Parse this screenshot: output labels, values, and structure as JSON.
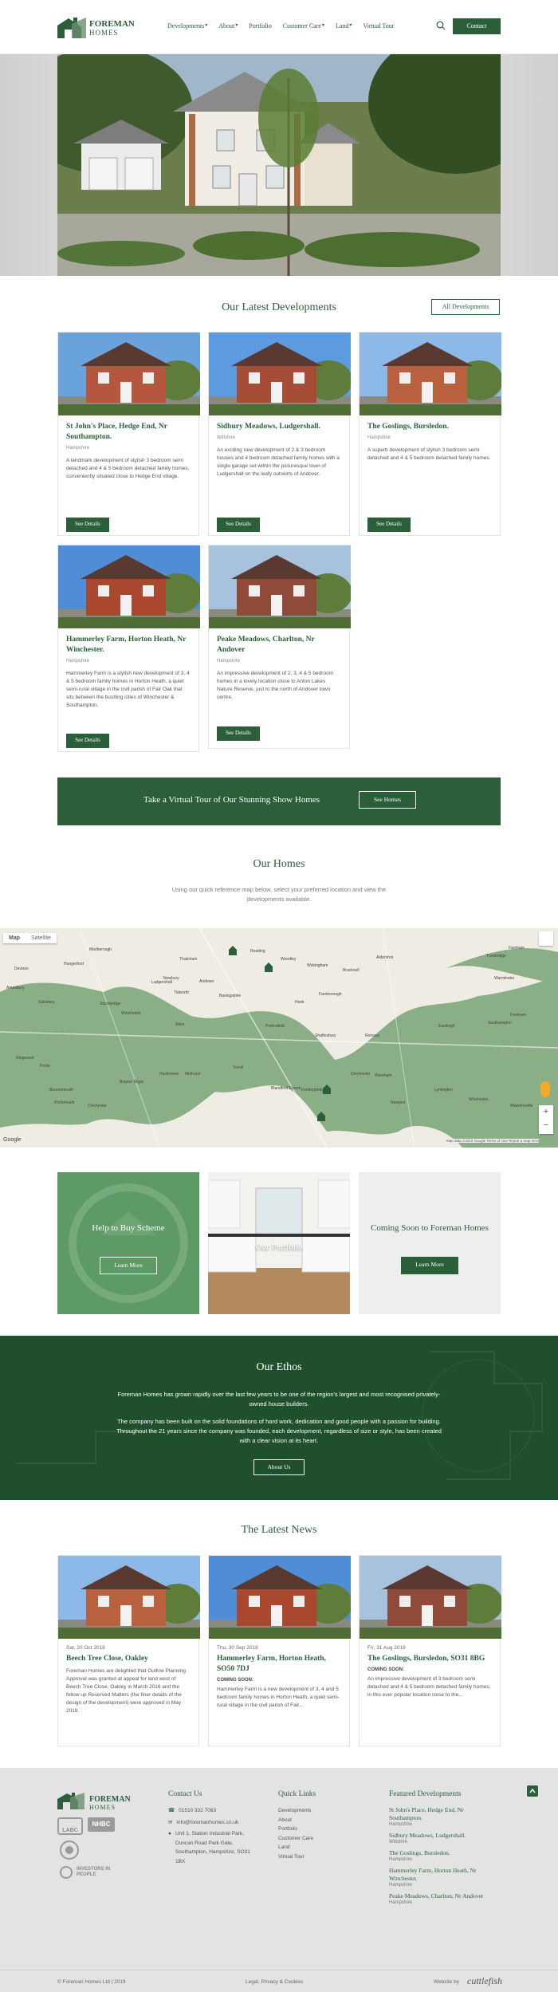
{
  "brand": {
    "name_top": "FOREMAN",
    "name_bottom": "HOMES"
  },
  "nav": {
    "items": [
      "Developments",
      "About",
      "Portfolio",
      "Customer Care",
      "Land",
      "Virtual Tour"
    ],
    "has_dropdown": [
      true,
      true,
      false,
      true,
      true,
      false
    ],
    "contact": "Contact"
  },
  "latest": {
    "title": "Our Latest Developments",
    "all_button": "All Developments",
    "cards": [
      {
        "title": "St John's Place, Hedge End, Nr Southampton.",
        "location": "Hampshire",
        "text": "A landmark development of stylish 3 bedroom semi detached and 4 & 5 bedroom detached family homes, conveniently situated close to Hedge End village.",
        "button": "See Details"
      },
      {
        "title": "Sidbury Meadows, Ludgershall.",
        "location": "Wiltshire",
        "text": "An exciting new development of 2 & 3 bedroom houses and 4 bedroom detached family homes with a single garage set within the picturesque town of Ludgershall on the leafy outskirts of Andover.",
        "button": "See Details"
      },
      {
        "title": "The Goslings, Bursledon.",
        "location": "Hampshire",
        "text": "A superb development of stylish 3 bedroom semi detached and 4 & 5 bedroom detached family homes.",
        "button": "See Details"
      },
      {
        "title": "Hammerley Farm, Horton Heath, Nr Winchester.",
        "location": "Hampshire",
        "text": "Hammerley Farm is a stylish new development of 3, 4 & 5 bedroom family homes in Horton Heath, a quiet semi-rural village in the civil parish of Fair Oak that sits between the bustling cities of Winchester & Southampton.",
        "button": "See Details"
      },
      {
        "title": "Peake Meadows, Charlton, Nr Andover",
        "location": "Hampshire",
        "text": "An impressive development of 2, 3, 4 & 5 bedroom homes in a lovely location close to Anton Lakes Nature Reserve, just to the north of Andover town centre.",
        "button": "See Details"
      }
    ]
  },
  "virtual": {
    "text": "Take a Virtual Tour of Our Stunning Show Homes",
    "button": "See Homes"
  },
  "homes": {
    "title": "Our Homes",
    "subtitle": "Using our quick reference map below, select your preferred location and view the developments available."
  },
  "map": {
    "tabs": [
      "Map",
      "Satellite"
    ],
    "places": [
      "Marlborough",
      "Hungerford",
      "Newbury",
      "Thatcham",
      "Reading",
      "Woodley",
      "Wokingham",
      "Bracknell",
      "Devizes",
      "Ludgershall",
      "Tidworth",
      "Andover",
      "Basingstoke",
      "Hook",
      "Farnborough",
      "Aldershot",
      "Farnham",
      "Trowbridge",
      "Warminster",
      "Amesbury",
      "Salisbury",
      "Stockbridge",
      "Winchester",
      "Alton",
      "Petersfield",
      "Shaftesbury",
      "Romsey",
      "Eastleigh",
      "Southampton",
      "Fareham",
      "Ringwood",
      "Poole",
      "Bournemouth",
      "Portsmouth",
      "Chichester",
      "Bognor Regis",
      "Haslemere",
      "Midhurst",
      "Yeovil",
      "Blandford Forum",
      "Fordingbridge",
      "Dorchester",
      "Wareham",
      "Newport",
      "Lymington",
      "Winchester",
      "Waterlooville"
    ],
    "footer": "Map data ©2019 Google  Terms of Use  Report a map error"
  },
  "tiles": [
    {
      "label": "Help to Buy Scheme",
      "button": "Learn More"
    },
    {
      "label": "Our Portfolio",
      "button": ""
    },
    {
      "label": "Coming Soon to Foreman Homes",
      "button": "Learn More"
    }
  ],
  "ethos": {
    "title": "Our Ethos",
    "p1": "Foreman Homes has grown rapidly over the last few years to be one of the region's largest and most recognised privately-owned house builders.",
    "p2": "The company has been built on the solid foundations of hard work, dedication and good people with a passion for building. Throughout the 21 years since the company was founded, each development, regardless of size or style, has been created with a clear vision at its heart.",
    "button": "About Us"
  },
  "news": {
    "title": "The Latest News",
    "items": [
      {
        "date": "Sat, 20 Oct 2018",
        "title": "Beech Tree Close, Oakley",
        "soon": "",
        "text": "Foreman Homes are delighted that Outline Planning Approval was granted at appeal for land west of Beech Tree Close, Oakley in March 2016 and the follow up Reserved Matters (the finer details of the design of the development) were approved in May 2018."
      },
      {
        "date": "Thu, 30 Sep 2018",
        "title": "Hammerley Farm, Horton Heath, SO50 7DJ",
        "soon": "COMING SOON:",
        "text": "Hammerley Farm is a new development of 3, 4 and 5 bedroom family homes in Horton Heath, a quiet semi-rural village in the civil parish of Fair..."
      },
      {
        "date": "Fri, 31 Aug 2018",
        "title": "The Goslings, Bursledon, SO31 8BG",
        "soon": "COMING SOON:",
        "text": "An impressive development of 3 bedroom semi detached and 4 & 5 bedroom detached family homes, in this ever popular location close to the..."
      }
    ]
  },
  "footer": {
    "badges": [
      "LABC",
      "NHBC",
      "INVESTORS IN PEOPLE"
    ],
    "contact": {
      "title": "Contact Us",
      "phone": "01510 332 7083",
      "email": "info@foremanhomes.co.uk",
      "address": "Unit 1, Station Industrial Park, Duncan Road Park Gate, Southampton, Hampshire, SO31 1BX"
    },
    "quick": {
      "title": "Quick Links",
      "links": [
        "Developments",
        "About",
        "Portfolio",
        "Customer Care",
        "Land",
        "Virtual Tour"
      ]
    },
    "featured": {
      "title": "Featured Developments",
      "items": [
        {
          "name": "St John's Place, Hedge End, Nr Southampton.",
          "region": "Hampshire"
        },
        {
          "name": "Sidbury Meadows, Ludgershall.",
          "region": "Wiltshire"
        },
        {
          "name": "The Goslings, Bursledon.",
          "region": "Hampshire"
        },
        {
          "name": "Hammerley Farm, Horton Heath, Nr Winchester.",
          "region": "Hampshire"
        },
        {
          "name": "Peake Meadows, Charlton, Nr Andover",
          "region": "Hampshire"
        }
      ]
    },
    "copyright": "© Foreman Homes Ltd | 2019",
    "legal": "Legal, Privacy & Cookies",
    "website_by": "Website by",
    "agency": "cuttlefish"
  },
  "colors": {
    "brand_green": "#2a5f3a",
    "dark_green": "#1f4f2d",
    "tile_green": "#5e9a65",
    "map_green": "#8aae86"
  }
}
